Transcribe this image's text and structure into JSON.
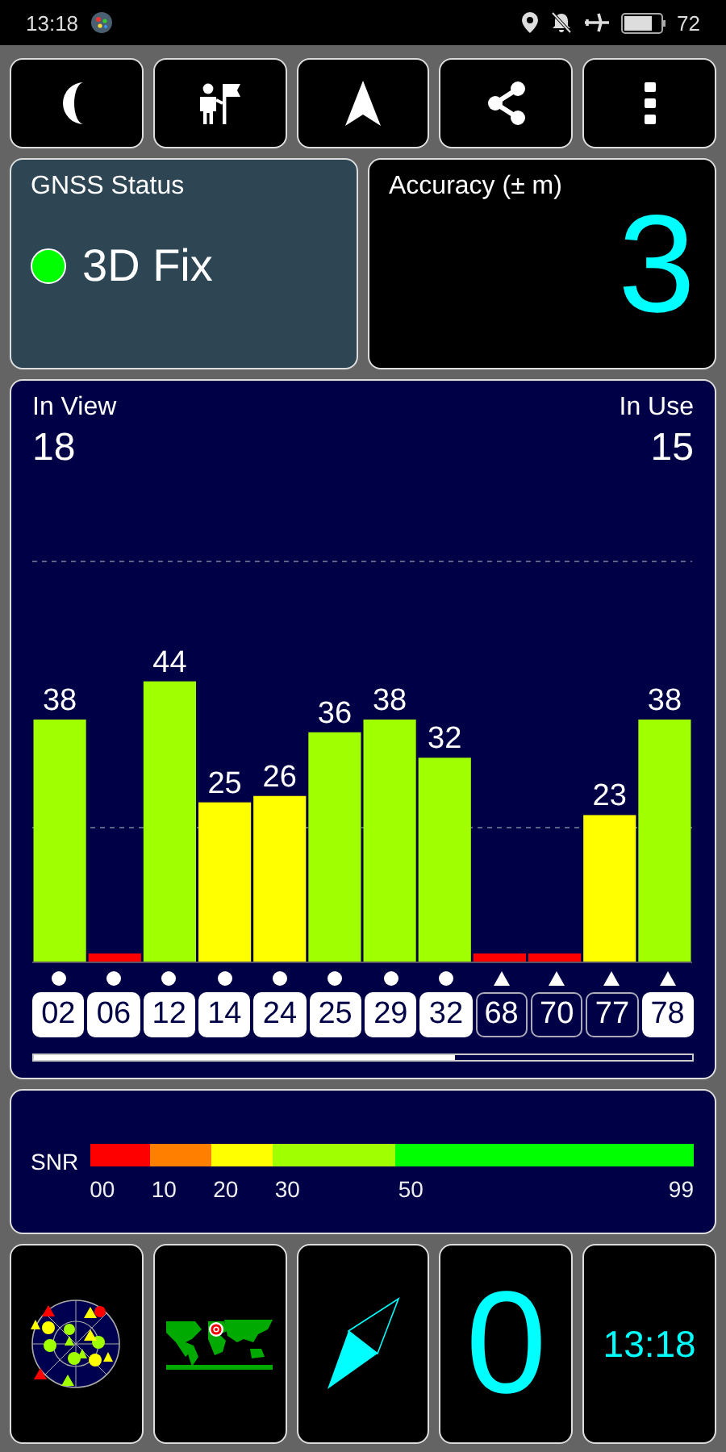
{
  "status_bar": {
    "time": "13:18",
    "battery": "72"
  },
  "toolbar": [
    {
      "kind": "moon"
    },
    {
      "kind": "person-flag"
    },
    {
      "kind": "arrow"
    },
    {
      "kind": "share"
    },
    {
      "kind": "more"
    }
  ],
  "gnss_status": {
    "title": "GNSS Status",
    "value": "3D Fix",
    "color": "#00ff00"
  },
  "accuracy": {
    "title": "Accuracy (± m)",
    "value": "3"
  },
  "sky": {
    "in_view_label": "In View",
    "in_view": "18",
    "in_use_label": "In Use",
    "in_use": "15",
    "chart_data": {
      "type": "bar",
      "categories": [
        "02",
        "06",
        "12",
        "14",
        "24",
        "25",
        "29",
        "32",
        "68",
        "70",
        "77",
        "78"
      ],
      "series": [
        {
          "values": [
            38,
            null,
            44,
            25,
            26,
            36,
            38,
            32,
            null,
            null,
            23,
            38
          ]
        }
      ],
      "data_labels": true
    },
    "satellites": [
      {
        "color": "#a0ff00",
        "kind": "dot",
        "selected": true
      },
      {
        "color": "#ff0000",
        "kind": "dot",
        "selected": true
      },
      {
        "color": "#a0ff00",
        "kind": "dot",
        "selected": true
      },
      {
        "color": "#ffff00",
        "kind": "dot",
        "selected": true
      },
      {
        "color": "#ffff00",
        "kind": "dot",
        "selected": true
      },
      {
        "color": "#a0ff00",
        "kind": "dot",
        "selected": true
      },
      {
        "color": "#a0ff00",
        "kind": "dot",
        "selected": true
      },
      {
        "color": "#a0ff00",
        "kind": "dot",
        "selected": true
      },
      {
        "color": "#ff0000",
        "kind": "triangle",
        "selected": false
      },
      {
        "color": "#ff0000",
        "kind": "triangle",
        "selected": false
      },
      {
        "color": "#ffff00",
        "kind": "triangle",
        "selected": false
      },
      {
        "color": "#a0ff00",
        "kind": "triangle",
        "selected": true
      }
    ]
  },
  "snr_legend": {
    "label": "SNR",
    "segments": [
      {
        "label": "00",
        "color": "#ff0000"
      },
      {
        "label": "10",
        "color": "#ff8000"
      },
      {
        "label": "20",
        "color": "#ffff00"
      },
      {
        "label": "30",
        "color": "#a0ff00"
      },
      {
        "label": "50",
        "color": "#00ff00"
      }
    ],
    "end_label": "99"
  },
  "bottom": {
    "speed": "0",
    "clock": "13:18"
  }
}
